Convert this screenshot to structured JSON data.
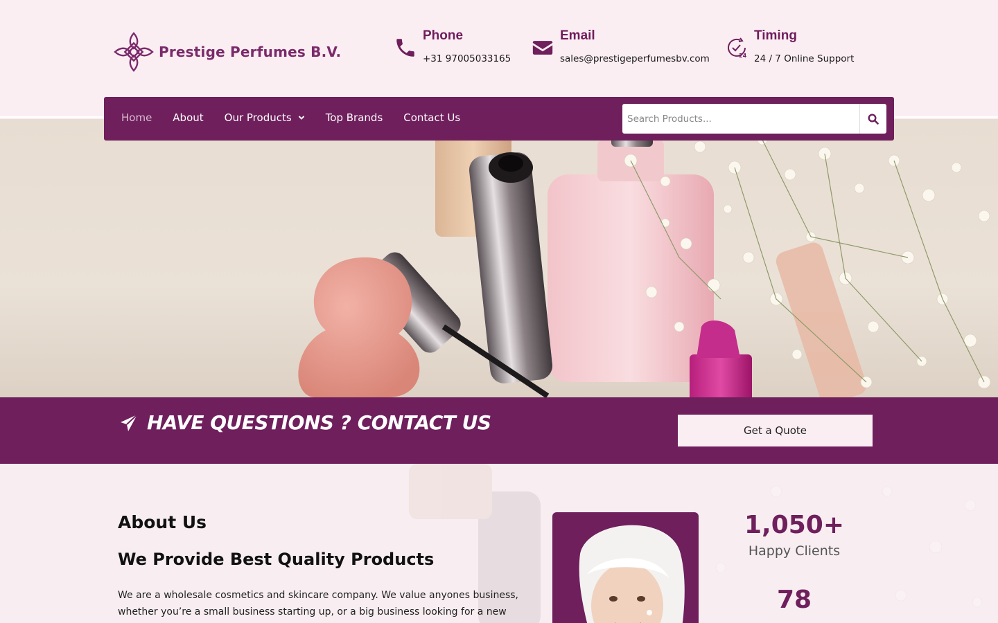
{
  "brand": {
    "name": "Prestige Perfumes B.V.",
    "color": "#6e1f5c"
  },
  "contact": {
    "phone": {
      "title": "Phone",
      "value": "+31 97005033165",
      "icon": "phone-icon"
    },
    "email": {
      "title": "Email",
      "value": "sales@prestigeperfumesbv.com",
      "icon": "envelope-icon"
    },
    "timing": {
      "title": "Timing",
      "value": "24 / 7 Online Support",
      "icon": "clock-24-icon"
    }
  },
  "nav": {
    "items": [
      {
        "label": "Home",
        "active": true
      },
      {
        "label": "About"
      },
      {
        "label": "Our Products",
        "has_dropdown": true
      },
      {
        "label": "Top Brands"
      },
      {
        "label": "Contact Us"
      }
    ],
    "search_placeholder": "Search Products...",
    "search_icon": "search-icon"
  },
  "cta": {
    "text": "HAVE QUESTIONS ? CONTACT US",
    "icon": "paper-plane-icon",
    "button": "Get a Quote"
  },
  "about": {
    "heading": "About Us",
    "subheading": "We Provide Best Quality Products",
    "body": "We are a wholesale cosmetics and skincare company. We value anyones business, whether you’re a small business starting up, or a big business looking for a new",
    "stats": [
      {
        "value": "1,050+",
        "label": "Happy Clients"
      },
      {
        "value": "78",
        "label": ""
      }
    ]
  },
  "colors": {
    "primary": "#6e1f5c",
    "background": "#fbeef3",
    "white": "#ffffff"
  }
}
